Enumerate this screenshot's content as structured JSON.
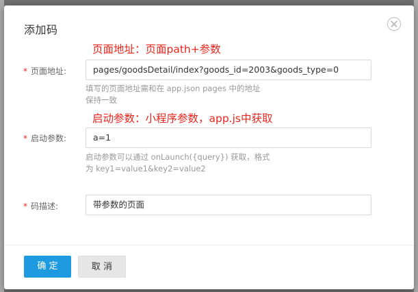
{
  "dialog": {
    "title": "添加码",
    "close_icon": "close-circle-icon"
  },
  "annotations": {
    "page_path_note": "页面地址：页面path+参数",
    "launch_params_note": "启动参数：小程序参数，app.js中获取"
  },
  "form": {
    "required_mark": "*",
    "page_path": {
      "label": "页面地址:",
      "value": "pages/goodsDetail/index?goods_id=2003&goods_type=0",
      "help_line1": "填写的页面地址需和在 app.json pages 中的地址",
      "help_line2": "保持一致"
    },
    "launch_params": {
      "label": "启动参数:",
      "value": "a=1",
      "help_line1": "启动参数可以通过 onLaunch({query}) 获取，格式",
      "help_line2": "为 key1=value1&key2=value2"
    },
    "description": {
      "label": "码描述:",
      "value": "带参数的页面"
    }
  },
  "footer": {
    "confirm_label": "确 定",
    "cancel_label": "取 消"
  },
  "colors": {
    "primary": "#1e9be0",
    "annotation": "#e8251c",
    "required": "#e8251c"
  }
}
